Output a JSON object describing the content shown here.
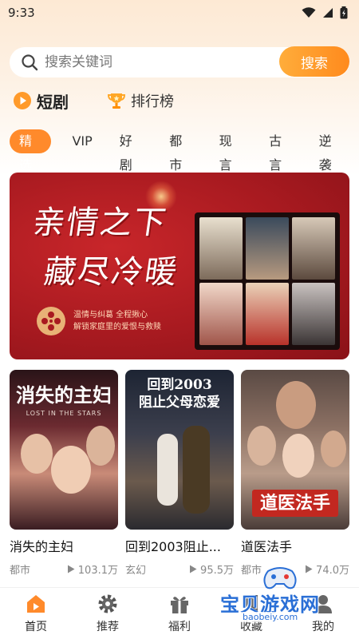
{
  "status_bar": {
    "time": "9:33"
  },
  "search": {
    "placeholder": "搜索关键词",
    "button_label": "搜索"
  },
  "section_tabs": [
    {
      "label": "短剧",
      "icon": "play-circle-icon",
      "active": true
    },
    {
      "label": "排行榜",
      "icon": "trophy-icon",
      "active": false
    }
  ],
  "categories": [
    {
      "label": "精选",
      "active": true
    },
    {
      "label": "VIP"
    },
    {
      "label": "好剧"
    },
    {
      "label": "都市"
    },
    {
      "label": "现言"
    },
    {
      "label": "古言"
    },
    {
      "label": "逆袭"
    }
  ],
  "banner": {
    "title_line1": "亲情之下",
    "title_line2": "藏尽冷暖",
    "subtitle_line1": "温情与纠葛 全程揪心",
    "subtitle_line2": "解锁家庭里的爱恨与救赎",
    "colors": {
      "background": "#a81a20",
      "accent": "#e8b276"
    }
  },
  "dramas": [
    {
      "poster_title": "消失的主妇",
      "poster_subtitle": "LOST IN THE STARS",
      "title": "消失的主妇",
      "genre": "都市",
      "views": "103.1万"
    },
    {
      "poster_title": "回到2003\n阻止父母恋爱",
      "title": "回到2003阻止...",
      "genre": "玄幻",
      "views": "95.5万"
    },
    {
      "poster_title": "道医法手",
      "title": "道医法手",
      "genre": "都市",
      "views": "74.0万"
    }
  ],
  "bottom_nav": [
    {
      "label": "首页",
      "icon": "home-play-icon",
      "active": true
    },
    {
      "label": "推荐",
      "icon": "gear-icon"
    },
    {
      "label": "福利",
      "icon": "gift-icon"
    },
    {
      "label": "收藏",
      "icon": "bookmark-icon"
    },
    {
      "label": "我的",
      "icon": "user-icon"
    }
  ],
  "watermark": {
    "text": "宝贝游戏网",
    "url": "baobeiy.com"
  },
  "theme": {
    "accent": "#ff8a2b",
    "accent_light": "#ffad3b"
  }
}
